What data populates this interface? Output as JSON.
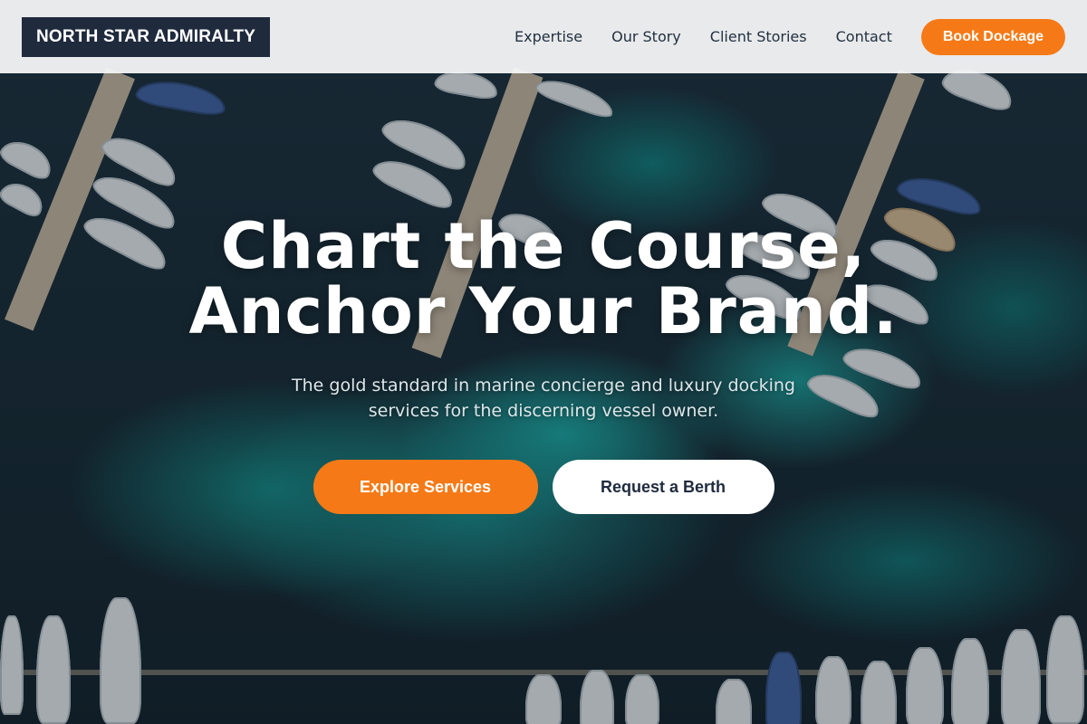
{
  "brand": {
    "name": "NORTH STAR ADMIRALTY"
  },
  "nav": {
    "links": [
      "Expertise",
      "Our Story",
      "Client Stories",
      "Contact"
    ],
    "cta": "Book Dockage"
  },
  "hero": {
    "title_line1": "Chart the Course,",
    "title_line2": "Anchor Your Brand.",
    "subtitle": "The gold standard in marine concierge and luxury docking services for the discerning vessel owner.",
    "primary_button": "Explore Services",
    "secondary_button": "Request a Berth",
    "background_image": "aerial-marina-photo"
  },
  "colors": {
    "accent": "#f57a17",
    "brand_dark": "#1f2a3d",
    "header_bg": "#f5f6f7"
  }
}
